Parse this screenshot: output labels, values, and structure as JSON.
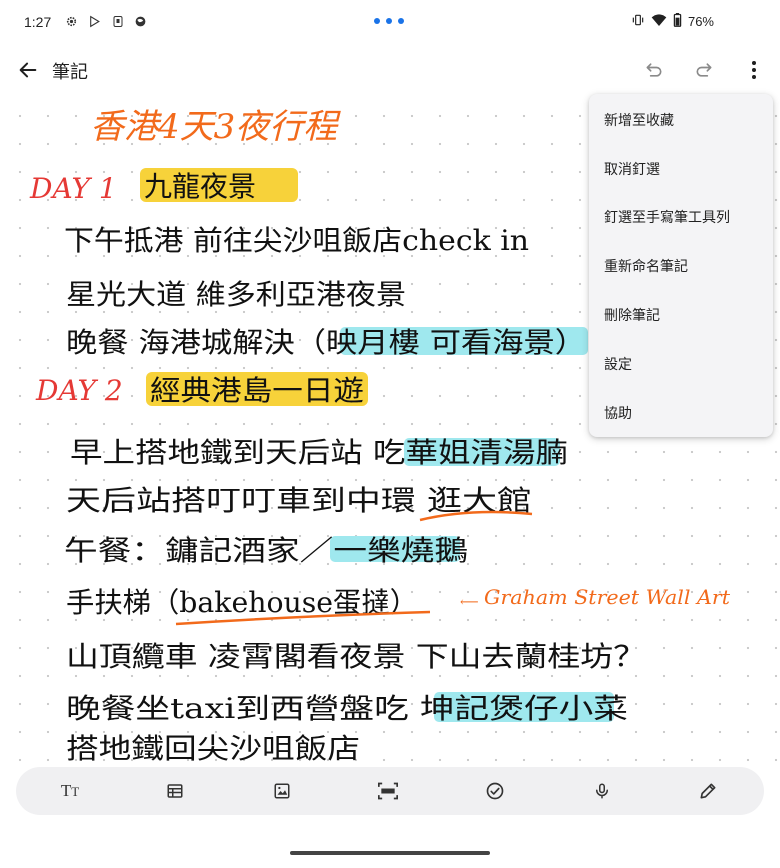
{
  "status_bar": {
    "time": "1:27",
    "battery": "76%",
    "left_icons": [
      "gear-icon",
      "play-store-icon",
      "nfc-icon",
      "globe-icon"
    ],
    "right_icons": [
      "vibrate-icon",
      "wifi-icon",
      "battery-icon"
    ]
  },
  "app_bar": {
    "title": "筆記",
    "back_icon": "arrow-left-icon",
    "undo_icon": "undo-icon",
    "redo_icon": "redo-icon",
    "more_icon": "more-vert-icon"
  },
  "menu": {
    "items": [
      "新增至收藏",
      "取消釘選",
      "釘選至手寫筆工具列",
      "重新命名筆記",
      "刪除筆記",
      "設定",
      "協助"
    ]
  },
  "note": {
    "title": "香港4天3夜行程",
    "lines": [
      {
        "day": "DAY 1",
        "text": "九龍夜景"
      },
      {
        "text": "下午抵港 前往尖沙咀飯店check in"
      },
      {
        "text": "星光大道 維多利亞港夜景"
      },
      {
        "text": "晚餐 海港城解決（映月樓 可看海景）"
      },
      {
        "day": "DAY 2",
        "text": "經典港島一日遊"
      },
      {
        "text": "早上搭地鐵到天后站 吃華姐清湯腩"
      },
      {
        "text": "天后站搭叮叮車到中環 逛大館"
      },
      {
        "text": "午餐：鏞記酒家／一樂燒鵝"
      },
      {
        "text": "手扶梯（bakehouse蛋撻）"
      },
      {
        "text": "Graham Street Wall Art"
      },
      {
        "text": "山頂纜車 凌霄閣看夜景 下山去蘭桂坊？"
      },
      {
        "text": "晚餐坐taxi到西營盤吃 坤記煲仔小菜"
      },
      {
        "text": "搭地鐵回尖沙咀飯店"
      }
    ]
  },
  "colors": {
    "ink_black": "#111111",
    "ink_orange": "#f26a1b",
    "ink_red": "#e53935",
    "highlight_yellow": "#f7d23a",
    "highlight_cyan": "#9fe8ee",
    "accent_blue": "#1a73e8",
    "menu_bg": "#f4f4f6",
    "toolbar_bg": "#f0f0f2"
  },
  "toolbar": {
    "tools": [
      {
        "name": "text-format-tool",
        "glyph": "TT"
      },
      {
        "name": "table-tool",
        "glyph": "table"
      },
      {
        "name": "image-tool",
        "glyph": "image"
      },
      {
        "name": "ocr-tool",
        "glyph": "OCR"
      },
      {
        "name": "checklist-tool",
        "glyph": "check"
      },
      {
        "name": "voice-tool",
        "glyph": "mic"
      },
      {
        "name": "pen-tool",
        "glyph": "pen"
      }
    ]
  }
}
